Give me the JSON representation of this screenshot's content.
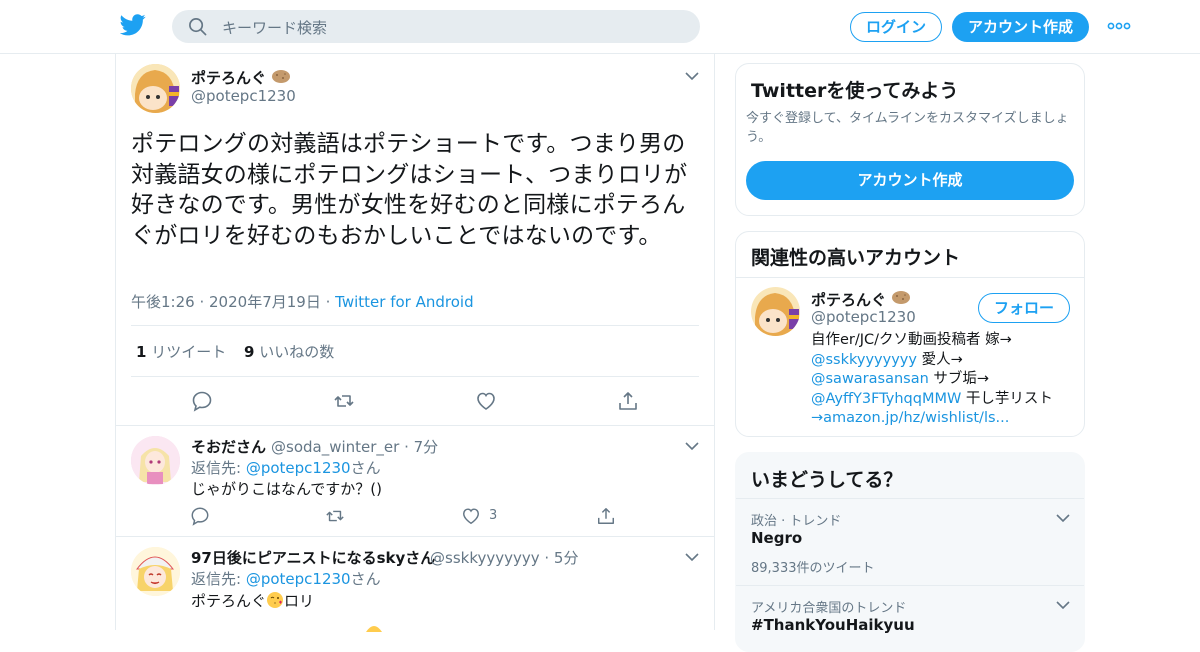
{
  "header": {
    "search_placeholder": "キーワード検索",
    "login_label": "ログイン",
    "signup_label": "アカウント作成"
  },
  "tweet": {
    "display_name": "ポテろんぐ",
    "handle": "@potepc1230",
    "text": "ポテロングの対義語はポテショートです。つまり男の対義語女の様にポテロングはショート、つまりロリが好きなのです。男性が女性を好むのと同様にポテろんぐがロリを好むのもおかしいことではないのです。",
    "time": "午後1:26",
    "date": "2020年7月19日",
    "source": "Twitter for Android",
    "retweet_count": "1",
    "retweet_label": "リツイート",
    "like_count": "9",
    "like_label": "いいねの数"
  },
  "replies": [
    {
      "display_name": "そおださん",
      "handle": "@soda_winter_er",
      "time": "7分",
      "reply_prefix": "返信先:",
      "reply_to": "@potepc1230",
      "reply_suffix": "さん",
      "text": "じゃがりこはなんですか？()",
      "like_count": "3"
    },
    {
      "display_name": "97日後にピアニストになるskyさん",
      "handle": "@sskkyyyyyyy",
      "time": "5分",
      "reply_prefix": "返信先:",
      "reply_to": "@potepc1230",
      "reply_suffix": "さん",
      "text_before_emoji": "ポテろんぐ",
      "text_after_emoji": "ロリ"
    }
  ],
  "signup_card": {
    "title": "Twitterを使ってみよう",
    "subtitle_line1": "今すぐ登録して、タイムラインをカスタマイズしましょ",
    "subtitle_line2": "う。",
    "button_label": "アカウント作成"
  },
  "related_card": {
    "title": "関連性の高いアカウント",
    "display_name": "ポテろんぐ",
    "handle": "@potepc1230",
    "follow_label": "フォロー",
    "bio_line1": "自作er/JC/クソ動画投稿者 嫁→",
    "bio_link1": "@sskkyyyyyyy",
    "bio_text2": " 愛人→",
    "bio_link2": "@sawarasansan",
    "bio_text3": " サブ垢→",
    "bio_link3": "@AyffY3FTyhqqMMW",
    "bio_text4": " 干し芋リスト",
    "bio_link4": "→amazon.jp/hz/wishlist/ls..."
  },
  "trends_card": {
    "title": "いまどうしてる？",
    "items": [
      {
        "category": "政治 · トレンド",
        "name": "Negro",
        "count": "89,333件のツイート"
      },
      {
        "category": "アメリカ合衆国のトレンド",
        "name": "#ThankYouHaikyuu"
      }
    ]
  },
  "colors": {
    "brand": "#1da1f2",
    "link": "#1b95e0",
    "muted": "#657786",
    "border": "#e6ecf0"
  }
}
